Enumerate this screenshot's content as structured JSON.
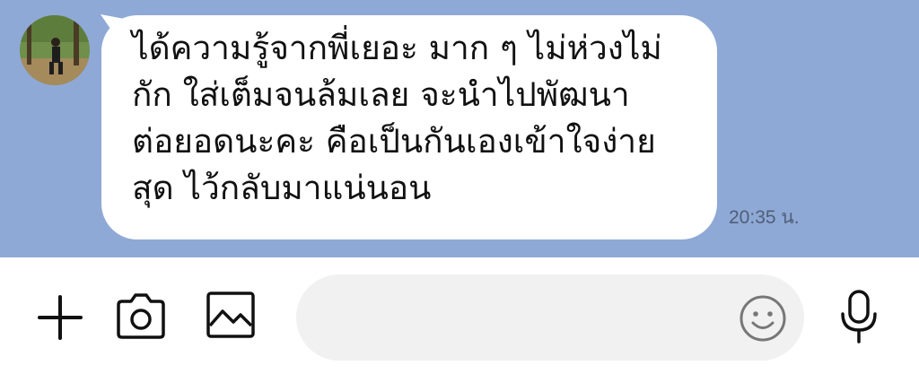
{
  "chat": {
    "message": {
      "text": "ได้ความรู้จากพี่เยอะ มาก ๆ ไม่ห่วงไม่\nกัก ใส่เต็มจนล้มเลย จะนำไปพัฒนา\nต่อยอดนะคะ คือเป็นกันเองเข้าใจง่าย\nสุด ไว้กลับมาแน่นอน",
      "time": "20:35 น."
    },
    "background_color": "#8fa9d6",
    "bubble_color": "#ffffff"
  },
  "input_bar": {
    "message_value": "",
    "icons": [
      "plus-icon",
      "camera-icon",
      "image-icon",
      "emoji-icon",
      "microphone-icon"
    ]
  }
}
